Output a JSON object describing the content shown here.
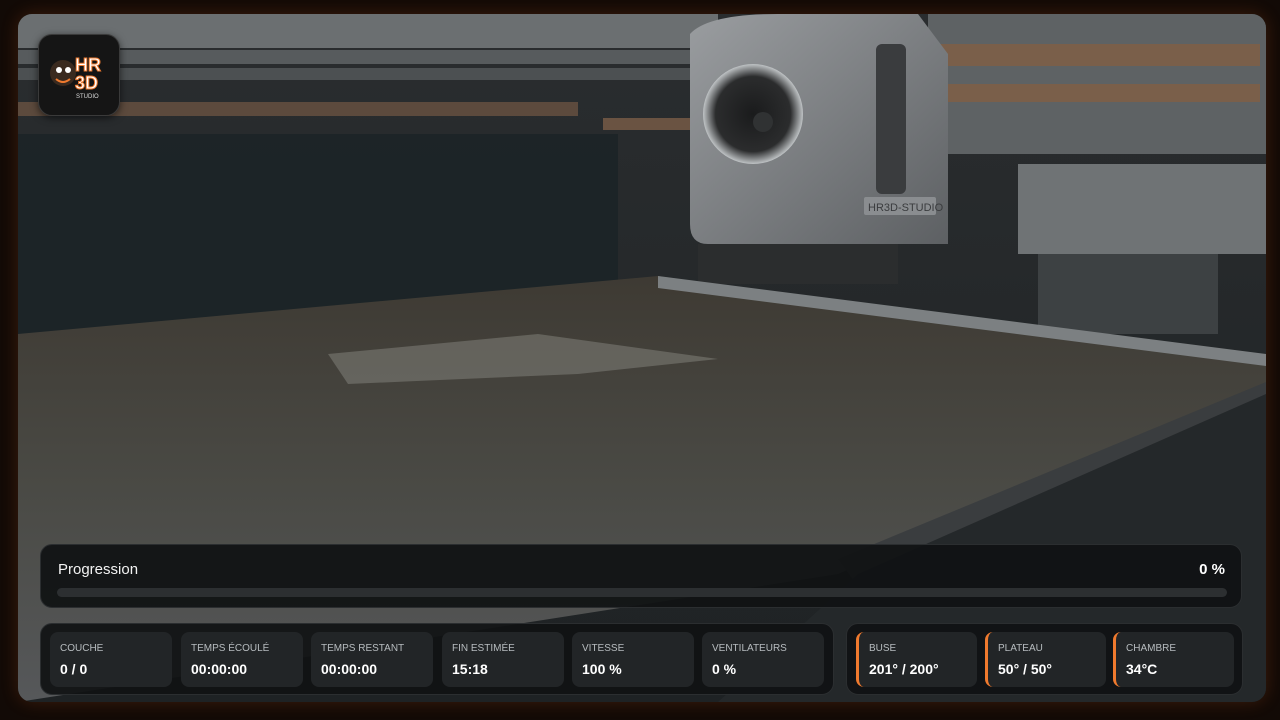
{
  "logo": {
    "line1": "HR",
    "line2": "3D",
    "line3": "STUDIO"
  },
  "camera": {
    "toolhead_text": "HR3D-STUDIO"
  },
  "progress": {
    "label": "Progression",
    "value_text": "0 %",
    "fraction": 0,
    "fill_color": "#f07a2e"
  },
  "stats": [
    {
      "label": "COUCHE",
      "value": "0 / 0"
    },
    {
      "label": "TEMPS ÉCOULÉ",
      "value": "00:00:00"
    },
    {
      "label": "TEMPS RESTANT",
      "value": "00:00:00"
    },
    {
      "label": "FIN ESTIMÉE",
      "value": "15:18"
    },
    {
      "label": "VITESSE",
      "value": "100 %"
    },
    {
      "label": "VENTILATEURS",
      "value": "0 %"
    }
  ],
  "temps": [
    {
      "label": "BUSE",
      "value": "201° / 200°"
    },
    {
      "label": "PLATEAU",
      "value": "50° / 50°"
    },
    {
      "label": "CHAMBRE",
      "value": "34°C"
    }
  ],
  "colors": {
    "accent": "#f07a2e",
    "panel": "#101213",
    "card": "#222527"
  }
}
